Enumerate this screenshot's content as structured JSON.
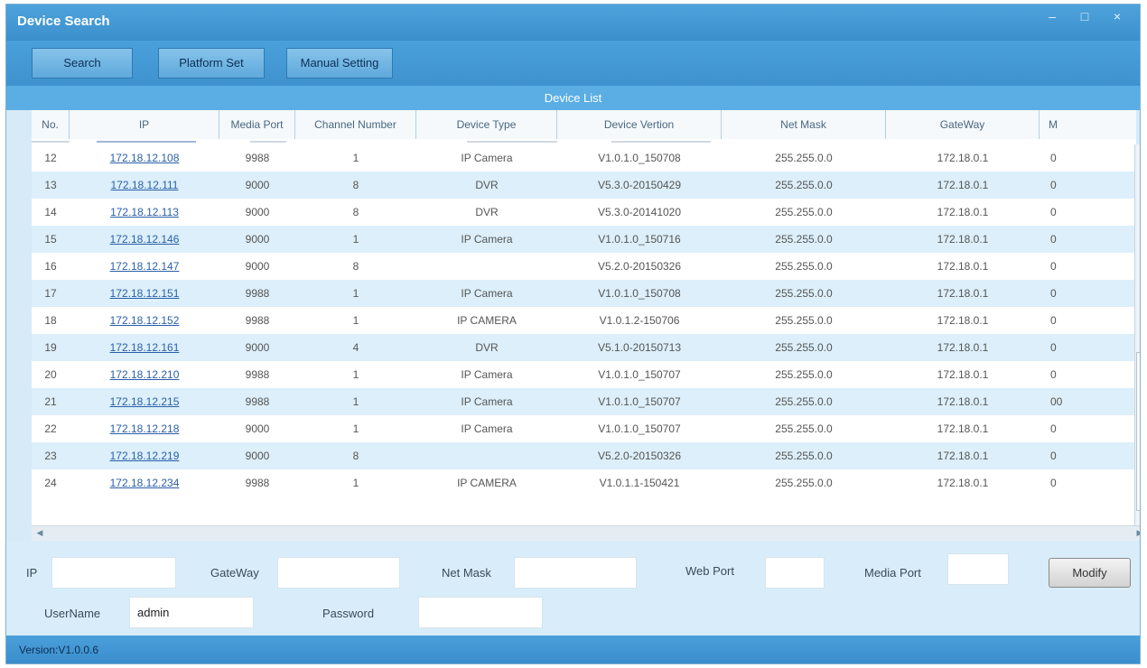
{
  "window": {
    "title": "Device Search",
    "controls": [
      "–",
      "□",
      "×"
    ]
  },
  "toolbar": {
    "search_label": "Search",
    "platform_label": "Platform Set",
    "manual_label": "Manual Setting"
  },
  "list": {
    "title": "Device List",
    "columns": [
      "No.",
      "IP",
      "Media Port",
      "Channel Number",
      "Device Type",
      "Device Vertion",
      "Net Mask",
      "GateWay",
      "M"
    ],
    "rows": [
      {
        "no": "12",
        "ip": "172.18.12.108",
        "port": "9988",
        "ch": "1",
        "type": "IP Camera",
        "ver": "V1.0.1.0_150708",
        "mask": "255.255.0.0",
        "gw": "172.18.0.1",
        "m": "0"
      },
      {
        "no": "13",
        "ip": "172.18.12.111",
        "port": "9000",
        "ch": "8",
        "type": "DVR",
        "ver": "V5.3.0-20150429",
        "mask": "255.255.0.0",
        "gw": "172.18.0.1",
        "m": "0"
      },
      {
        "no": "14",
        "ip": "172.18.12.113",
        "port": "9000",
        "ch": "8",
        "type": "DVR",
        "ver": "V5.3.0-20141020",
        "mask": "255.255.0.0",
        "gw": "172.18.0.1",
        "m": "0"
      },
      {
        "no": "15",
        "ip": "172.18.12.146",
        "port": "9000",
        "ch": "1",
        "type": "IP Camera",
        "ver": "V1.0.1.0_150716",
        "mask": "255.255.0.0",
        "gw": "172.18.0.1",
        "m": "0"
      },
      {
        "no": "16",
        "ip": "172.18.12.147",
        "port": "9000",
        "ch": "8",
        "type": "",
        "ver": "V5.2.0-20150326",
        "mask": "255.255.0.0",
        "gw": "172.18.0.1",
        "m": "0"
      },
      {
        "no": "17",
        "ip": "172.18.12.151",
        "port": "9988",
        "ch": "1",
        "type": "IP Camera",
        "ver": "V1.0.1.0_150708",
        "mask": "255.255.0.0",
        "gw": "172.18.0.1",
        "m": "0"
      },
      {
        "no": "18",
        "ip": "172.18.12.152",
        "port": "9988",
        "ch": "1",
        "type": "IP CAMERA",
        "ver": "V1.0.1.2-150706",
        "mask": "255.255.0.0",
        "gw": "172.18.0.1",
        "m": "0"
      },
      {
        "no": "19",
        "ip": "172.18.12.161",
        "port": "9000",
        "ch": "4",
        "type": "DVR",
        "ver": "V5.1.0-20150713",
        "mask": "255.255.0.0",
        "gw": "172.18.0.1",
        "m": "0"
      },
      {
        "no": "20",
        "ip": "172.18.12.210",
        "port": "9988",
        "ch": "1",
        "type": "IP Camera",
        "ver": "V1.0.1.0_150707",
        "mask": "255.255.0.0",
        "gw": "172.18.0.1",
        "m": "0"
      },
      {
        "no": "21",
        "ip": "172.18.12.215",
        "port": "9988",
        "ch": "1",
        "type": "IP Camera",
        "ver": "V1.0.1.0_150707",
        "mask": "255.255.0.0",
        "gw": "172.18.0.1",
        "m": "00"
      },
      {
        "no": "22",
        "ip": "172.18.12.218",
        "port": "9000",
        "ch": "1",
        "type": "IP Camera",
        "ver": "V1.0.1.0_150707",
        "mask": "255.255.0.0",
        "gw": "172.18.0.1",
        "m": "0"
      },
      {
        "no": "23",
        "ip": "172.18.12.219",
        "port": "9000",
        "ch": "8",
        "type": "",
        "ver": "V5.2.0-20150326",
        "mask": "255.255.0.0",
        "gw": "172.18.0.1",
        "m": "0"
      },
      {
        "no": "24",
        "ip": "172.18.12.234",
        "port": "9988",
        "ch": "1",
        "type": "IP CAMERA",
        "ver": "V1.0.1.1-150421",
        "mask": "255.255.0.0",
        "gw": "172.18.0.1",
        "m": "0"
      }
    ]
  },
  "form": {
    "ip_label": "IP",
    "ip_value": "",
    "gateway_label": "GateWay",
    "gateway_value": "",
    "netmask_label": "Net Mask",
    "netmask_value": "",
    "webport_label": "Web Port",
    "webport_value": "",
    "mediaport_label": "Media Port",
    "mediaport_value": "",
    "modify_label": "Modify",
    "username_label": "UserName",
    "username_value": "admin",
    "password_label": "Password",
    "password_value": ""
  },
  "status": {
    "version": "Version:V1.0.0.6"
  },
  "colors": {
    "title_bar": "#4fa3dc",
    "list_header": "#5aaee4",
    "row_alt": "#dceffa",
    "link": "#2a5fa8",
    "panel": "#d8edf9"
  },
  "icons": {
    "scroll_up": "up-arrow-icon",
    "scroll_down": "down-arrow-icon",
    "scroll_left": "left-arrow-icon",
    "scroll_right": "right-arrow-icon"
  }
}
